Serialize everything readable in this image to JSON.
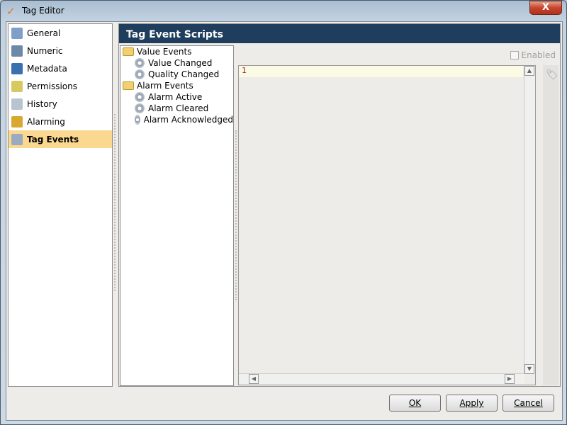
{
  "window": {
    "title": "Tag Editor",
    "close_label": "X"
  },
  "nav": {
    "items": [
      {
        "label": "General",
        "icon": "clipboard-icon",
        "color": "#7f9fc8"
      },
      {
        "label": "Numeric",
        "icon": "calculator-icon",
        "color": "#6c8aa8"
      },
      {
        "label": "Metadata",
        "icon": "info-icon",
        "color": "#3a6fb0"
      },
      {
        "label": "Permissions",
        "icon": "lock-icon",
        "color": "#d8c860"
      },
      {
        "label": "History",
        "icon": "history-icon",
        "color": "#b8c4d0"
      },
      {
        "label": "Alarming",
        "icon": "bell-icon",
        "color": "#d8a830"
      },
      {
        "label": "Tag Events",
        "icon": "tag-events-icon",
        "color": "#9aaac0",
        "selected": true
      }
    ]
  },
  "panel": {
    "title": "Tag Event Scripts",
    "enabled_label": "Enabled",
    "enabled": false,
    "line_number": "1"
  },
  "tree": [
    {
      "label": "Value Events",
      "children": [
        "Value Changed",
        "Quality Changed"
      ]
    },
    {
      "label": "Alarm Events",
      "children": [
        "Alarm Active",
        "Alarm Cleared",
        "Alarm Acknowledged"
      ]
    }
  ],
  "buttons": {
    "ok": "OK",
    "apply": "Apply",
    "cancel": "Cancel"
  }
}
